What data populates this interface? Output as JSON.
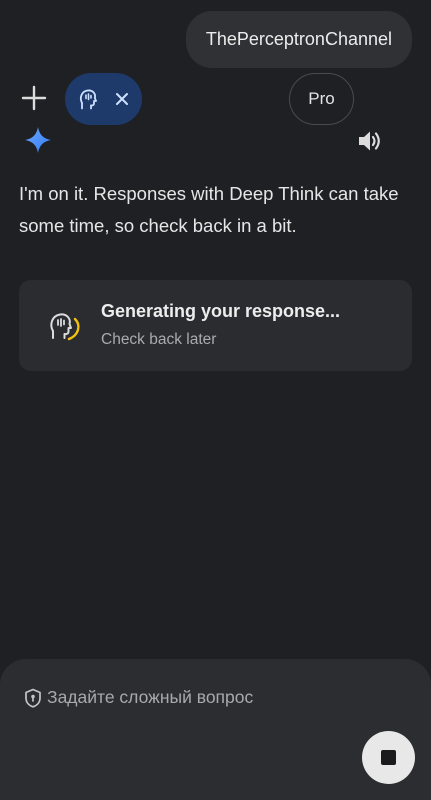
{
  "user_message": "ThePerceptronChannel",
  "assistant": {
    "icon": "gemini-spark-icon",
    "reply": "I'm on it. Responses with Deep Think can take some time, so check back in a bit.",
    "status_card": {
      "icon": "deep-think-icon",
      "title": "Generating your response...",
      "subtitle": "Check back later"
    }
  },
  "composer": {
    "placeholder": "Задайте сложный вопрос",
    "mode_chip_icon": "deep-think-icon",
    "model_label": "Pro"
  },
  "colors": {
    "background": "#1f2023",
    "bubble": "#303134",
    "card": "#2b2c2f",
    "chip": "#1d3a6b",
    "spark": "#4f8df7",
    "progress": "#f4c20d"
  }
}
